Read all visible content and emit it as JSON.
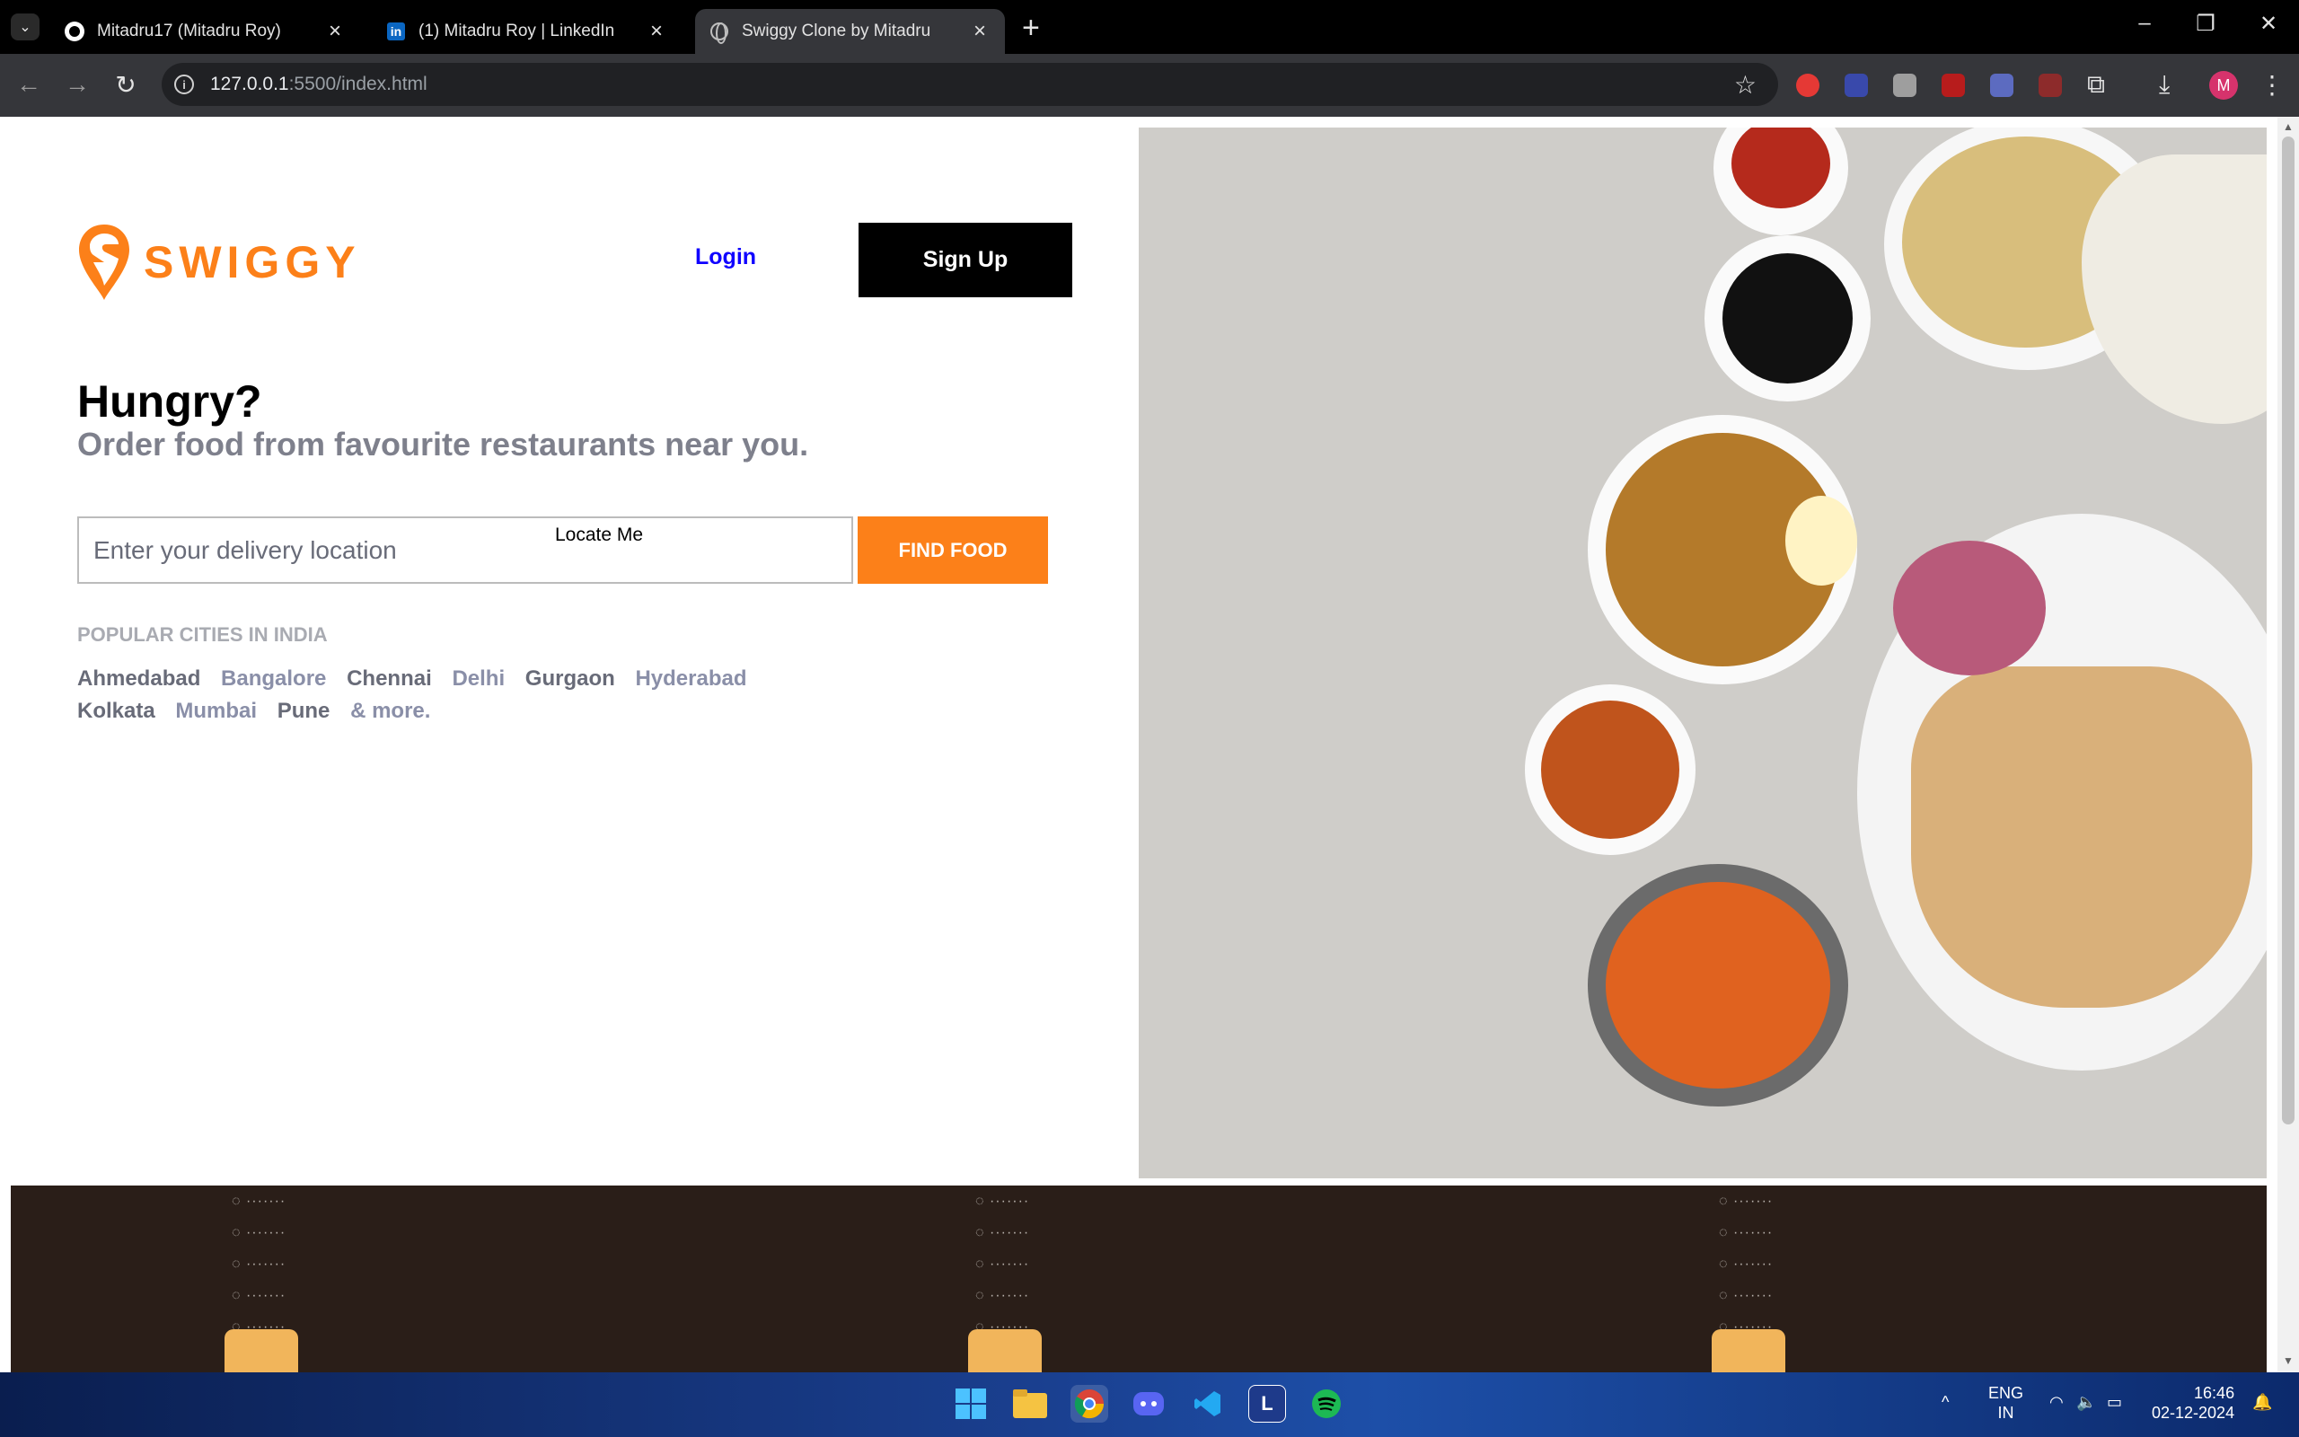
{
  "browser": {
    "tabs": [
      {
        "title": "Mitadru17 (Mitadru Roy)",
        "favicon": "github-icon",
        "active": false
      },
      {
        "title": "(1) Mitadru Roy | LinkedIn",
        "favicon": "linkedin-icon",
        "active": false
      },
      {
        "title": "Swiggy Clone by Mitadru",
        "favicon": "globe-icon",
        "active": true
      }
    ],
    "url_host": "127.0.0.1",
    "url_path": ":5500/index.html",
    "profile_initial": "M"
  },
  "page": {
    "logo_text": "SWIGGY",
    "login_label": "Login",
    "signup_label": "Sign Up",
    "hero_title": "Hungry?",
    "hero_subtitle": "Order food from favourite restaurants near you.",
    "location_placeholder": "Enter your delivery location",
    "locate_me_label": "Locate Me",
    "find_food_label": "FIND FOOD",
    "popular_title": "POPULAR CITIES IN INDIA",
    "cities": [
      {
        "name": "Ahmedabad",
        "tone": "dark"
      },
      {
        "name": "Bangalore",
        "tone": "light"
      },
      {
        "name": "Chennai",
        "tone": "dark"
      },
      {
        "name": "Delhi",
        "tone": "light"
      },
      {
        "name": "Gurgaon",
        "tone": "dark"
      },
      {
        "name": "Hyderabad",
        "tone": "light"
      },
      {
        "name": "Kolkata",
        "tone": "dark"
      },
      {
        "name": "Mumbai",
        "tone": "light"
      },
      {
        "name": "Pune",
        "tone": "dark"
      },
      {
        "name": "& more.",
        "tone": "light"
      }
    ],
    "colors": {
      "brand": "#fc8019",
      "login": "#1000ff",
      "footer": "#2a1e18"
    }
  },
  "taskbar": {
    "lang_top": "ENG",
    "lang_bottom": "IN",
    "time": "16:46",
    "date": "02-12-2024",
    "apps": [
      "windows-start-icon",
      "file-explorer-icon",
      "chrome-icon",
      "discord-icon",
      "vscode-icon",
      "l-app-icon",
      "spotify-icon"
    ]
  }
}
